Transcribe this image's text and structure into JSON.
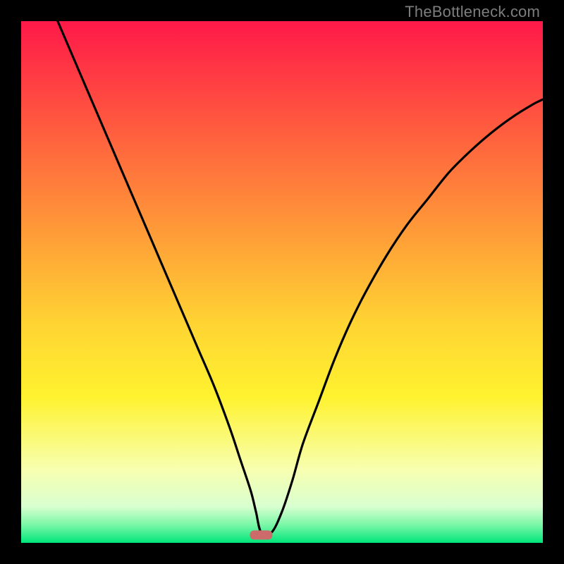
{
  "watermark": "TheBottleneck.com",
  "colors": {
    "frame_bg": "#000000",
    "curve_stroke": "#000000",
    "marker_fill": "#cd6a6a",
    "gradient_stops": [
      {
        "offset": 0.0,
        "color": "#ff1949"
      },
      {
        "offset": 0.2,
        "color": "#ff5a3f"
      },
      {
        "offset": 0.4,
        "color": "#ff9a38"
      },
      {
        "offset": 0.58,
        "color": "#ffd433"
      },
      {
        "offset": 0.72,
        "color": "#fff22f"
      },
      {
        "offset": 0.86,
        "color": "#f7ffb0"
      },
      {
        "offset": 0.93,
        "color": "#d9ffd0"
      },
      {
        "offset": 0.965,
        "color": "#7cf7a8"
      },
      {
        "offset": 1.0,
        "color": "#00e57a"
      }
    ]
  },
  "chart_data": {
    "type": "line",
    "title": "",
    "xlabel": "",
    "ylabel": "",
    "xlim": [
      0,
      100
    ],
    "ylim": [
      0,
      100
    ],
    "grid": false,
    "legend": false,
    "series": [
      {
        "name": "bottleneck-curve",
        "x": [
          7,
          10,
          13,
          16,
          19,
          22,
          25,
          28,
          31,
          34,
          37,
          40,
          42,
          44,
          45,
          46,
          48,
          50,
          52,
          54,
          57,
          60,
          63,
          66,
          70,
          74,
          78,
          82,
          86,
          90,
          94,
          98,
          100
        ],
        "y": [
          100,
          93,
          86,
          79,
          72,
          65,
          58,
          51,
          44,
          37,
          30,
          22,
          16,
          10,
          6,
          2,
          2,
          6,
          12,
          19,
          27,
          35,
          42,
          48,
          55,
          61,
          66,
          71,
          75,
          78.5,
          81.5,
          84,
          85
        ]
      }
    ],
    "annotations": [
      {
        "name": "optimal-marker",
        "x": 46,
        "y": 1.5,
        "shape": "rounded-rect"
      }
    ]
  }
}
